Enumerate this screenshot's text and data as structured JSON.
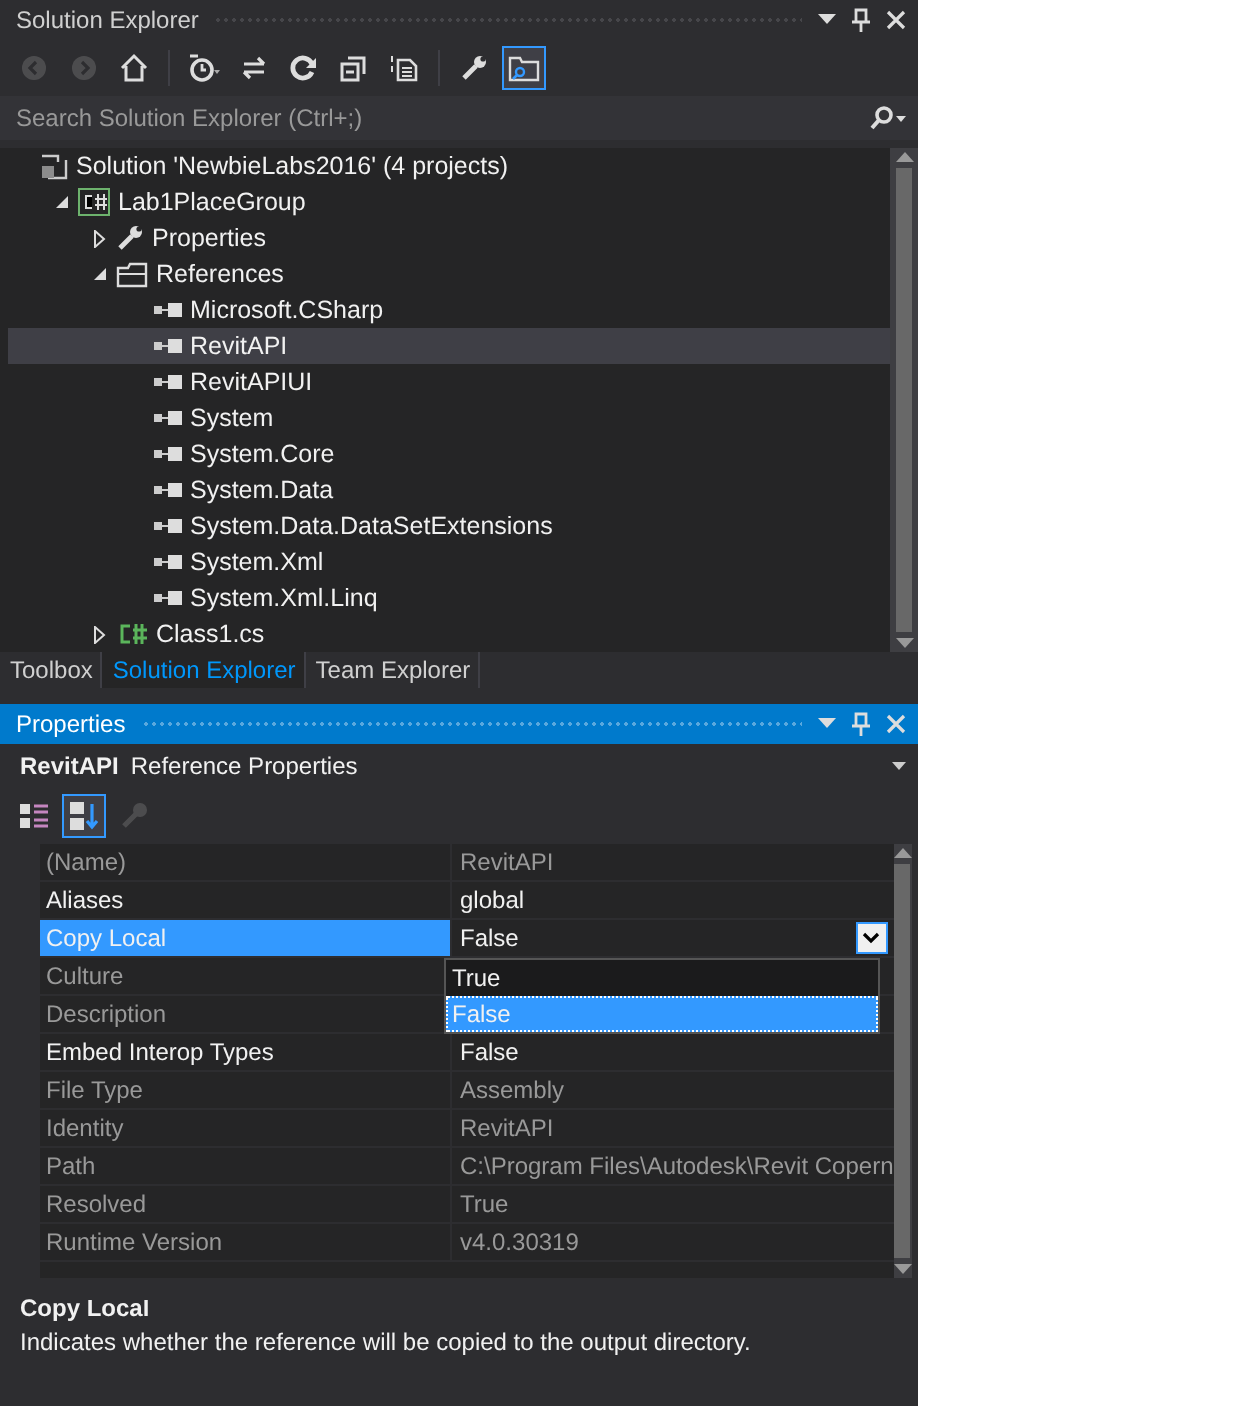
{
  "solution_explorer": {
    "title": "Solution Explorer",
    "toolbar": [
      {
        "kind": "back",
        "disabled": true,
        "selected": false
      },
      {
        "kind": "forward",
        "disabled": true,
        "selected": false
      },
      {
        "kind": "home",
        "disabled": false,
        "selected": false
      },
      {
        "kind": "history",
        "disabled": false,
        "selected": false
      },
      {
        "kind": "sync",
        "disabled": false,
        "selected": false
      },
      {
        "kind": "refresh",
        "disabled": false,
        "selected": false
      },
      {
        "kind": "collapse",
        "disabled": false,
        "selected": false
      },
      {
        "kind": "show-files",
        "disabled": false,
        "selected": false
      },
      {
        "kind": "wrench",
        "disabled": false,
        "selected": false
      },
      {
        "kind": "preview",
        "disabled": false,
        "selected": true
      }
    ],
    "search": {
      "placeholder": "Search Solution Explorer (Ctrl+;)"
    },
    "tree": [
      {
        "label": "Solution 'NewbieLabs2016' (4 projects)",
        "kind": "solution",
        "selected": false,
        "children": [
          {
            "label": "Lab1PlaceGroup",
            "kind": "project",
            "expanded": true,
            "selected": false,
            "children": [
              {
                "label": "Properties",
                "kind": "properties",
                "expanded": false,
                "selected": false
              },
              {
                "label": "References",
                "kind": "folder",
                "expanded": true,
                "selected": false,
                "children": [
                  {
                    "label": "Microsoft.CSharp",
                    "kind": "reference",
                    "selected": false
                  },
                  {
                    "label": "RevitAPI",
                    "kind": "reference",
                    "selected": true
                  },
                  {
                    "label": "RevitAPIUI",
                    "kind": "reference",
                    "selected": false
                  },
                  {
                    "label": "System",
                    "kind": "reference",
                    "selected": false
                  },
                  {
                    "label": "System.Core",
                    "kind": "reference",
                    "selected": false
                  },
                  {
                    "label": "System.Data",
                    "kind": "reference",
                    "selected": false
                  },
                  {
                    "label": "System.Data.DataSetExtensions",
                    "kind": "reference",
                    "selected": false
                  },
                  {
                    "label": "System.Xml",
                    "kind": "reference",
                    "selected": false
                  },
                  {
                    "label": "System.Xml.Linq",
                    "kind": "reference",
                    "selected": false
                  }
                ]
              },
              {
                "label": "Class1.cs",
                "kind": "file",
                "expanded": false,
                "selected": false
              }
            ]
          }
        ]
      }
    ],
    "tabs": [
      {
        "label": "Toolbox",
        "selected": false
      },
      {
        "label": "Solution Explorer",
        "selected": true
      },
      {
        "label": "Team Explorer",
        "selected": false
      }
    ]
  },
  "properties": {
    "title": "Properties",
    "object_name": "RevitAPI",
    "object_type": "Reference Properties",
    "toolbar": [
      {
        "kind": "categorized",
        "disabled": false,
        "selected": false
      },
      {
        "kind": "alphabetical",
        "disabled": false,
        "selected": true
      },
      {
        "kind": "property-pages",
        "disabled": true,
        "selected": false
      }
    ],
    "rows": [
      {
        "name": "(Name)",
        "value": "RevitAPI",
        "editable": false,
        "selected": false
      },
      {
        "name": "Aliases",
        "value": "global",
        "editable": true,
        "selected": false
      },
      {
        "name": "Copy Local",
        "value": "False",
        "editable": true,
        "selected": true
      },
      {
        "name": "Culture",
        "value": "",
        "editable": false,
        "selected": false
      },
      {
        "name": "Description",
        "value": "",
        "editable": false,
        "selected": false
      },
      {
        "name": "Embed Interop Types",
        "value": "False",
        "editable": true,
        "selected": false
      },
      {
        "name": "File Type",
        "value": "Assembly",
        "editable": false,
        "selected": false
      },
      {
        "name": "Identity",
        "value": "RevitAPI",
        "editable": false,
        "selected": false
      },
      {
        "name": "Path",
        "value": "C:\\Program Files\\Autodesk\\Revit Copern",
        "editable": false,
        "selected": false
      },
      {
        "name": "Resolved",
        "value": "True",
        "editable": false,
        "selected": false
      },
      {
        "name": "Runtime Version",
        "value": "v4.0.30319",
        "editable": false,
        "selected": false
      }
    ],
    "dropdown": {
      "options": [
        {
          "label": "True",
          "selected": false
        },
        {
          "label": "False",
          "selected": true
        }
      ]
    },
    "description": {
      "title": "Copy Local",
      "text": "Indicates whether the reference will be copied to the output directory."
    }
  }
}
